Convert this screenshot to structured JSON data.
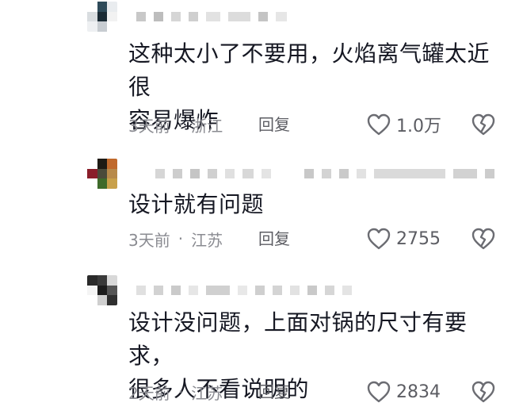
{
  "comments": [
    {
      "text_lines": [
        "这种太小了不要用，火焰离气罐太近很",
        "容易爆炸"
      ],
      "time": "3天前",
      "separator": "·",
      "location": "浙江",
      "reply_label": "回复",
      "likes": "1.0万"
    },
    {
      "text_lines": [
        "设计就有问题"
      ],
      "time": "3天前",
      "separator": "·",
      "location": "江苏",
      "reply_label": "回复",
      "likes": "2755"
    },
    {
      "text_lines": [
        "设计没问题，上面对锅的尺寸有要求，",
        "很多人不看说明的"
      ],
      "time": "2天前",
      "separator": "·",
      "location": "江苏",
      "reply_label": "回复",
      "likes": "2834"
    }
  ],
  "icons": {
    "like": "heart-outline-icon",
    "dislike": "broken-heart-icon"
  },
  "colors": {
    "text": "#161823",
    "meta": "#8a8b91",
    "action": "#5c5d63"
  }
}
